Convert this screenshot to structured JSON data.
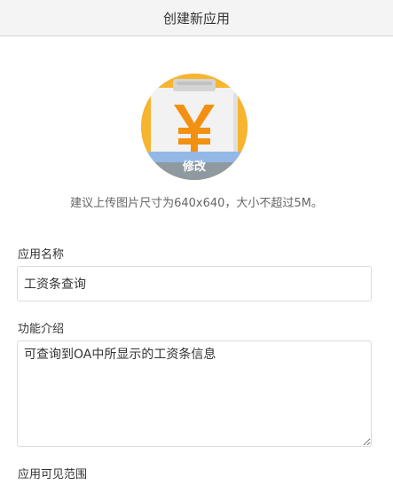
{
  "header": {
    "title": "创建新应用"
  },
  "app_icon": {
    "name": "yen-clipboard-icon",
    "symbol": "¥",
    "edit_label": "修改",
    "colors": {
      "circle": "#f6b42f",
      "paper": "#f2f2f2",
      "clip": "#d4d4d4",
      "yen": "#f29111",
      "band_blue": "#93b8e6",
      "band_gray": "#8f9aa0"
    }
  },
  "upload_hint": "建议上传图片尺寸为640x640，大小不超过5M。",
  "form": {
    "name_label": "应用名称",
    "name_value": "工资条查询",
    "description_label": "功能介绍",
    "description_value": "可查询到OA中所显示的工资条信息",
    "visibility_label": "应用可见范围"
  }
}
